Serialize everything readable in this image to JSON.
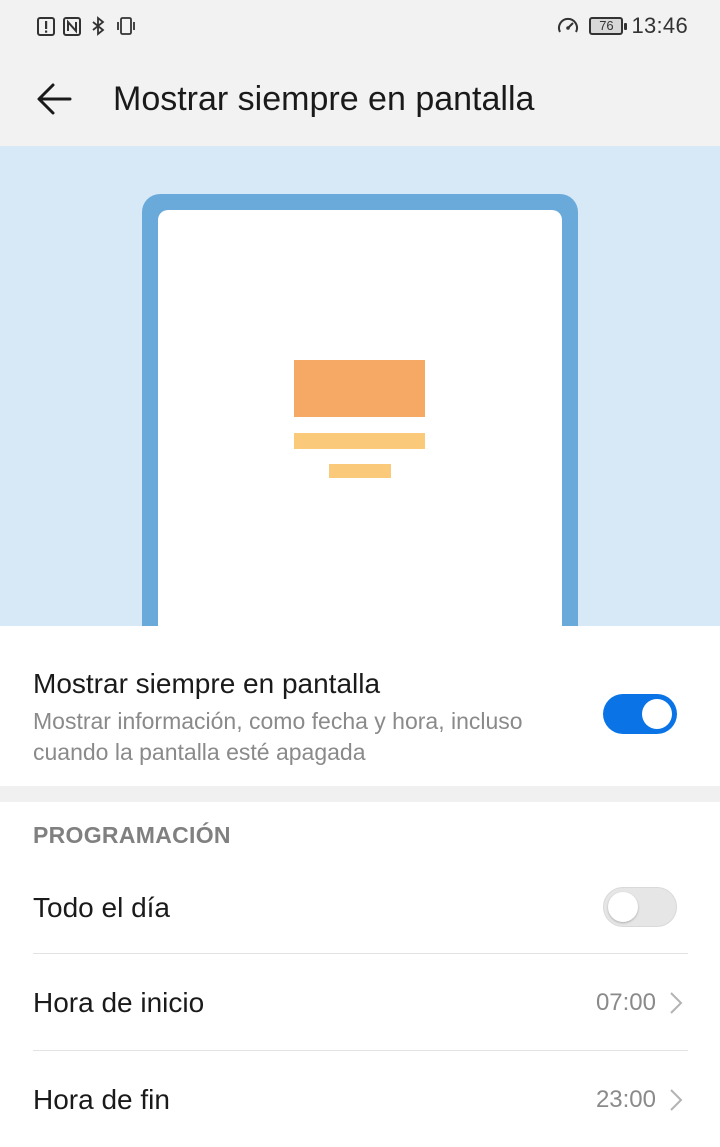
{
  "status_bar": {
    "left_icons": [
      "alert-icon",
      "nfc-icon",
      "bluetooth-icon",
      "vibrate-icon"
    ],
    "right_icons": [
      "speed-icon"
    ],
    "battery": "76",
    "time": "13:46"
  },
  "header": {
    "title": "Mostrar siempre en pantalla",
    "back_icon": "arrow-left-icon"
  },
  "illustration": {
    "frame_color": "#6aaadb",
    "background_color": "#d7e9f7",
    "block_color": "#f6a964",
    "line_color": "#fac97a"
  },
  "aod_setting": {
    "title": "Mostrar siempre en pantalla",
    "subtitle": "Mostrar información, como fecha y hora, incluso cuando la pantalla esté apagada",
    "enabled": true
  },
  "schedule": {
    "header": "PROGRAMACIÓN",
    "all_day": {
      "label": "Todo el día",
      "enabled": false
    },
    "start": {
      "label": "Hora de inicio",
      "value": "07:00"
    },
    "end": {
      "label": "Hora de fin",
      "value": "23:00"
    }
  },
  "colors": {
    "accent": "#0a74e6",
    "text_primary": "#1a1a1a",
    "text_secondary": "#8a8a8a"
  }
}
